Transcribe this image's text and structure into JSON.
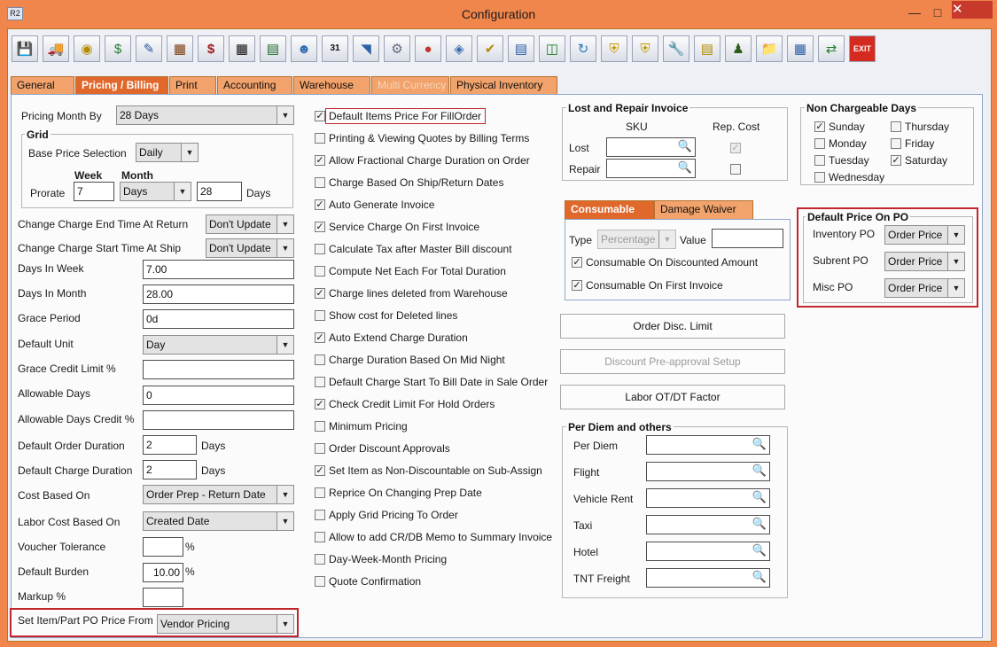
{
  "window": {
    "title": "Configuration",
    "icon": "R2"
  },
  "toolbar": {
    "icons": [
      "save-icon",
      "ship-icon",
      "coins-icon",
      "money-icon",
      "edit-icon",
      "report-icon",
      "invoice-icon",
      "grid-icon",
      "ledger-icon",
      "user-icon",
      "calendar-icon",
      "ruler-icon",
      "gear-icon",
      "color-icon",
      "box-icon",
      "check-icon",
      "card-icon",
      "document-icon",
      "document-refresh-icon",
      "shield-icon",
      "shield-gear-icon",
      "wrench-icon",
      "notes-icon",
      "person-icon",
      "folder-icon",
      "calculator-icon",
      "transfer-icon",
      "exit-icon"
    ]
  },
  "tabs": [
    {
      "label": "General"
    },
    {
      "label": "Pricing / Billing"
    },
    {
      "label": "Print"
    },
    {
      "label": "Accounting"
    },
    {
      "label": "Warehouse"
    },
    {
      "label": "Multi Currency"
    },
    {
      "label": "Physical Inventory"
    }
  ],
  "left": {
    "pricing_month_by": {
      "label": "Pricing Month By",
      "value": "28 Days"
    },
    "grid": {
      "title": "Grid",
      "base_price_label": "Base Price Selection",
      "base_price_value": "Daily",
      "week_label": "Week",
      "month_label": "Month",
      "prorate_label": "Prorate",
      "prorate_week": "7",
      "prorate_month_unit": "Days",
      "prorate_month_value": "28",
      "days_suffix": "Days"
    },
    "change_end": {
      "label": "Change Charge End Time At Return",
      "value": "Don't Update"
    },
    "change_start": {
      "label": "Change Charge Start Time At Ship",
      "value": "Don't Update"
    },
    "days_in_week": {
      "label": "Days In Week",
      "value": "7.00"
    },
    "days_in_month": {
      "label": "Days In Month",
      "value": "28.00"
    },
    "grace_period": {
      "label": "Grace Period",
      "value": "0d"
    },
    "default_unit": {
      "label": "Default Unit",
      "value": "Day"
    },
    "grace_credit": {
      "label": "Grace Credit Limit %",
      "value": ""
    },
    "allowable_days": {
      "label": "Allowable Days",
      "value": "0"
    },
    "allowable_credit": {
      "label": "Allowable Days Credit %",
      "value": ""
    },
    "order_duration": {
      "label": "Default Order Duration",
      "value": "2",
      "unit": "Days"
    },
    "charge_duration": {
      "label": "Default Charge Duration",
      "value": "2",
      "unit": "Days"
    },
    "cost_based_on": {
      "label": "Cost Based On",
      "value": "Order Prep - Return Date"
    },
    "labor_cost": {
      "label": "Labor Cost Based On",
      "value": "Created Date"
    },
    "voucher_tolerance": {
      "label": "Voucher Tolerance",
      "value": "",
      "unit": "%"
    },
    "default_burden": {
      "label": "Default Burden",
      "value": "10.00",
      "unit": "%"
    },
    "markup": {
      "label": "Markup %",
      "value": ""
    },
    "po_price_from": {
      "label": "Set Item/Part PO Price From",
      "value": "Vendor Pricing"
    }
  },
  "checks": [
    {
      "label": "Default Items Price For FillOrder",
      "checked": true
    },
    {
      "label": "Printing & Viewing Quotes by Billing Terms",
      "checked": false
    },
    {
      "label": "Allow Fractional Charge Duration on Order",
      "checked": true
    },
    {
      "label": "Charge Based On Ship/Return Dates",
      "checked": false
    },
    {
      "label": "Auto Generate Invoice",
      "checked": true
    },
    {
      "label": "Service Charge On First Invoice",
      "checked": true
    },
    {
      "label": "Calculate Tax after Master Bill discount",
      "checked": false
    },
    {
      "label": "Compute Net Each For Total Duration",
      "checked": false
    },
    {
      "label": "Charge lines deleted from Warehouse",
      "checked": true
    },
    {
      "label": "Show cost for Deleted lines",
      "checked": false
    },
    {
      "label": "Auto Extend Charge Duration",
      "checked": true
    },
    {
      "label": "Charge Duration Based On Mid Night",
      "checked": false
    },
    {
      "label": "Default Charge Start To Bill Date in Sale Order",
      "checked": false
    },
    {
      "label": "Check Credit Limit For Hold Orders",
      "checked": true
    },
    {
      "label": "Minimum Pricing",
      "checked": false
    },
    {
      "label": "Order Discount Approvals",
      "checked": false
    },
    {
      "label": "Set Item as Non-Discountable on Sub-Assign",
      "checked": true
    },
    {
      "label": "Reprice On Changing Prep Date",
      "checked": false
    },
    {
      "label": "Apply Grid Pricing To Order",
      "checked": false
    },
    {
      "label": "Allow to add CR/DB Memo to Summary Invoice",
      "checked": false
    },
    {
      "label": "Day-Week-Month Pricing",
      "checked": false
    },
    {
      "label": "Quote Confirmation",
      "checked": false
    }
  ],
  "lost_repair": {
    "title": "Lost and Repair Invoice",
    "sku_header": "SKU",
    "rep_cost_header": "Rep. Cost",
    "lost_label": "Lost",
    "repair_label": "Repair"
  },
  "consumable": {
    "tabs": [
      "Consumable",
      "Damage Waiver"
    ],
    "type_label": "Type",
    "type_value": "Percentage",
    "value_label": "Value",
    "on_discounted": "Consumable On Discounted Amount",
    "on_first_invoice": "Consumable On First Invoice"
  },
  "buttons": {
    "order_disc_limit": "Order Disc. Limit",
    "discount_preapproval": "Discount Pre-approval Setup",
    "labor_ot_dt": "Labor OT/DT Factor"
  },
  "per_diem": {
    "title": "Per Diem and others",
    "items": [
      "Per Diem",
      "Flight",
      "Vehicle Rent",
      "Taxi",
      "Hotel",
      "TNT Freight"
    ]
  },
  "non_chargeable": {
    "title": "Non Chargeable Days",
    "days": [
      {
        "label": "Sunday",
        "checked": true
      },
      {
        "label": "Monday",
        "checked": false
      },
      {
        "label": "Tuesday",
        "checked": false
      },
      {
        "label": "Wednesday",
        "checked": false
      },
      {
        "label": "Thursday",
        "checked": false
      },
      {
        "label": "Friday",
        "checked": false
      },
      {
        "label": "Saturday",
        "checked": true
      }
    ]
  },
  "default_price_po": {
    "title": "Default Price On PO",
    "items": [
      {
        "label": "Inventory PO",
        "value": "Order Price"
      },
      {
        "label": "Subrent PO",
        "value": "Order Price"
      },
      {
        "label": "Misc PO",
        "value": "Order Price"
      }
    ]
  }
}
